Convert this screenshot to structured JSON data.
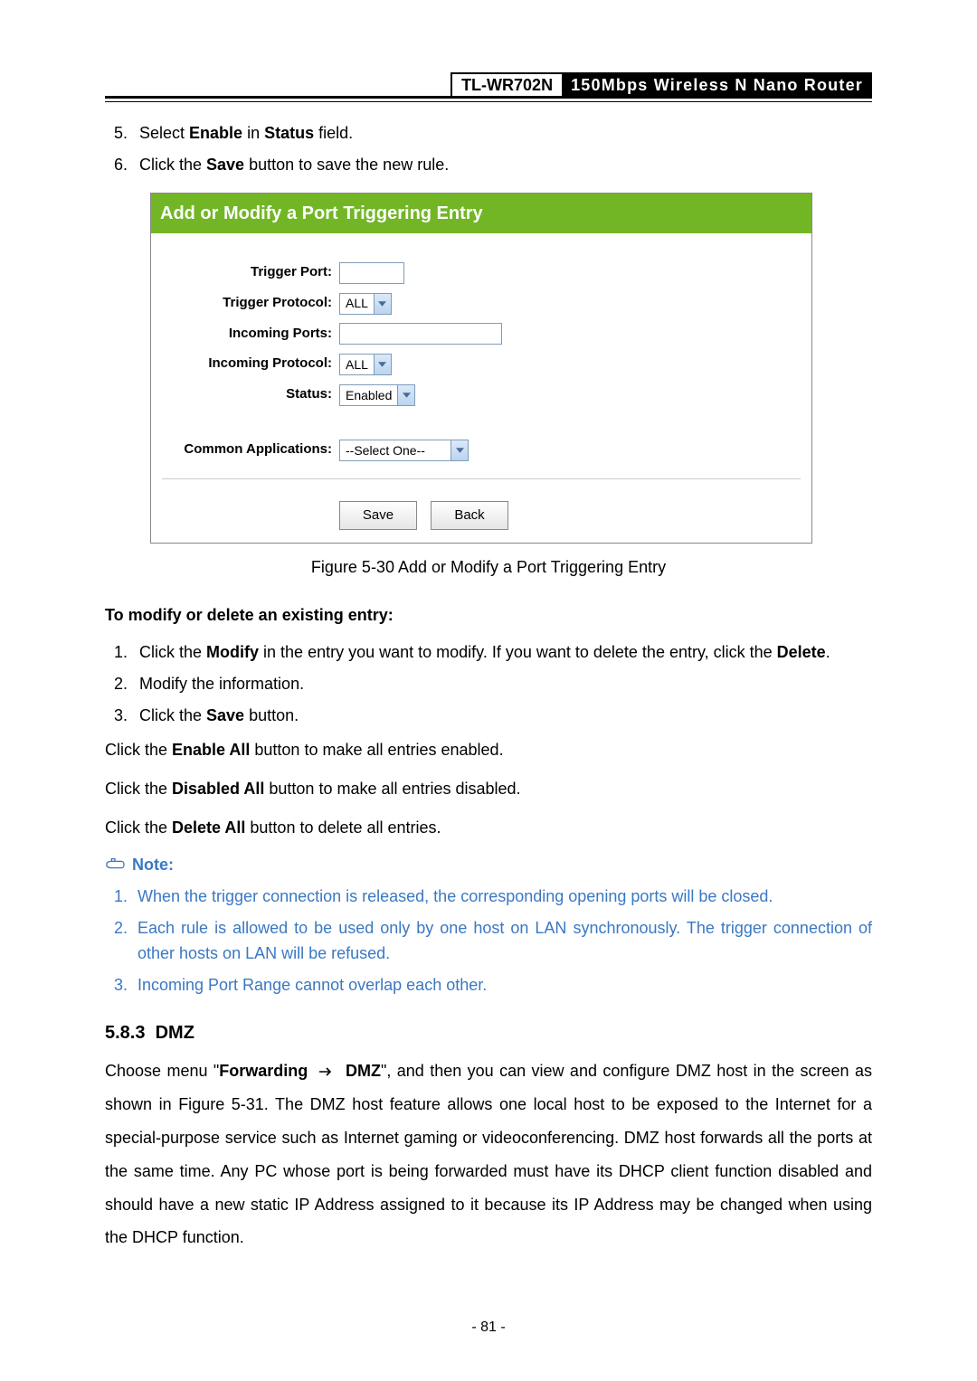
{
  "header": {
    "model": "TL-WR702N",
    "desc": "150Mbps Wireless N Nano Router"
  },
  "steps_top": [
    {
      "num": "5.",
      "pre": "Select ",
      "b1": "Enable",
      "mid": " in ",
      "b2": "Status",
      "post": " field."
    },
    {
      "num": "6.",
      "pre": "Click the ",
      "b1": "Save",
      "mid": " button to save the new rule.",
      "b2": "",
      "post": ""
    }
  ],
  "shot": {
    "title": "Add or Modify a Port Triggering Entry",
    "rows": {
      "trigger_port": "Trigger Port:",
      "trigger_proto": "Trigger Protocol:",
      "incoming_ports": "Incoming Ports:",
      "incoming_proto": "Incoming Protocol:",
      "status": "Status:",
      "common_apps": "Common Applications:"
    },
    "values": {
      "trigger_proto": "ALL",
      "incoming_proto": "ALL",
      "status": "Enabled",
      "common_apps": "--Select One--"
    },
    "buttons": {
      "save": "Save",
      "back": "Back"
    }
  },
  "caption": "Figure 5-30    Add or Modify a Port Triggering Entry",
  "modify_heading": "To modify or delete an existing entry:",
  "modify_steps": {
    "s1a": "Click the ",
    "s1b": "Modify",
    "s1c": " in the entry you want to modify. If you want to delete the entry, click the ",
    "s1d": "Delete",
    "s1e": ".",
    "s2": "Modify the information.",
    "s3a": "Click the ",
    "s3b": "Save",
    "s3c": " button."
  },
  "bulk": {
    "l1a": "Click the ",
    "l1b": "Enable All",
    "l1c": " button to make all entries enabled.",
    "l2a": "Click the ",
    "l2b": "Disabled All",
    "l2c": " button to make all entries disabled.",
    "l3a": "Click the ",
    "l3b": "Delete All",
    "l3c": " button to delete all entries."
  },
  "note_label": "Note:",
  "notes": [
    "When the trigger connection is released, the corresponding opening ports will be closed.",
    "Each rule is allowed to be used only by one host on LAN synchronously. The trigger connection of other hosts on LAN will be refused.",
    "Incoming Port Range cannot overlap each other."
  ],
  "sec": {
    "num": "5.8.3",
    "title": "DMZ"
  },
  "dmz": {
    "p1a": "Choose menu \"",
    "p1b": "Forwarding",
    "p1c": "DMZ",
    "p1d": "\", and then you can view and configure DMZ host in the screen as shown in Figure 5-31. The DMZ host feature allows one local host to be exposed to the Internet for a special-purpose service such as Internet gaming or videoconferencing. DMZ host forwards all the ports at the same time. Any PC whose port is being forwarded must have its DHCP client function disabled and should have a new static IP Address assigned to it because its IP Address may be changed when using the DHCP function."
  },
  "page_number": "- 81 -"
}
